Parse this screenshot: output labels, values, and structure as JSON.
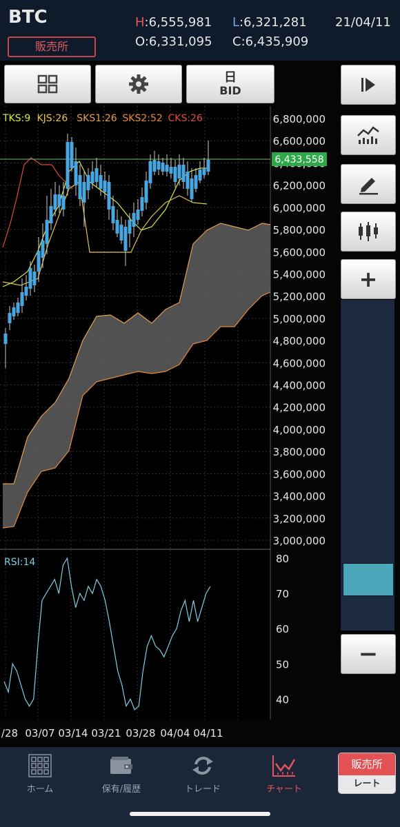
{
  "header": {
    "symbol": "BTC",
    "market": "販売所",
    "high_label": "H",
    "high_value": ":6,555,981",
    "low_label": "L",
    "low_value": ":6,321,281",
    "open_text": "O:6,331,095",
    "close_text": "C:6,435,909",
    "date": "21/04/11"
  },
  "toolbar": {
    "layout_icon": "grid-icon",
    "settings_icon": "gear-icon",
    "period_label": "日",
    "price_type_label": "BID"
  },
  "chart": {
    "indicator_params": [
      {
        "text": "TKS:9",
        "color": "#d8e84a"
      },
      {
        "text": "KJS:26",
        "color": "#e0c64a"
      },
      {
        "text": "SKS1:26",
        "color": "#e8a04a"
      },
      {
        "text": "SKS2:52",
        "color": "#e88a3a"
      },
      {
        "text": "CKS:26",
        "color": "#e04a3a"
      }
    ],
    "price_ticks": [
      "6,800,000",
      "6,600,000",
      "6,400,000",
      "6,200,000",
      "6,000,000",
      "5,800,000",
      "5,600,000",
      "5,400,000",
      "5,200,000",
      "5,000,000",
      "4,800,000",
      "4,600,000",
      "4,400,000",
      "4,200,000",
      "4,000,000",
      "3,800,000",
      "3,600,000",
      "3,400,000",
      "3,200,000",
      "3,000,000"
    ],
    "current_price": "6,433,558",
    "rsi_label": "RSI:14",
    "rsi_ticks": [
      "80",
      "70",
      "60",
      "50",
      "40"
    ],
    "date_ticks": [
      "/28",
      "03/07",
      "03/14",
      "03/21",
      "03/28",
      "04/04",
      "04/11"
    ],
    "colors": {
      "up": "#e03a3a",
      "down": "#4aa6e0",
      "cloud": "#5a5a5a",
      "rsi": "#7fd0e0",
      "price_tag": "#2fa84a"
    }
  },
  "side": {
    "play_icon": "play-next-icon",
    "line_chart_icon": "line-chart-icon",
    "draw_icon": "pencil-icon",
    "candle_icon": "candlestick-icon",
    "zoom_in": "+",
    "zoom_out": "−",
    "zoom_level": 0.88
  },
  "nav": {
    "items": [
      {
        "label": "ホーム",
        "icon": "home-grid-icon"
      },
      {
        "label": "保有/履歴",
        "icon": "wallet-icon"
      },
      {
        "label": "トレード",
        "icon": "trade-arrows-icon"
      },
      {
        "label": "チャート",
        "icon": "chart-icon"
      }
    ],
    "rate_top": "販売所",
    "rate_bottom": "レート"
  }
}
